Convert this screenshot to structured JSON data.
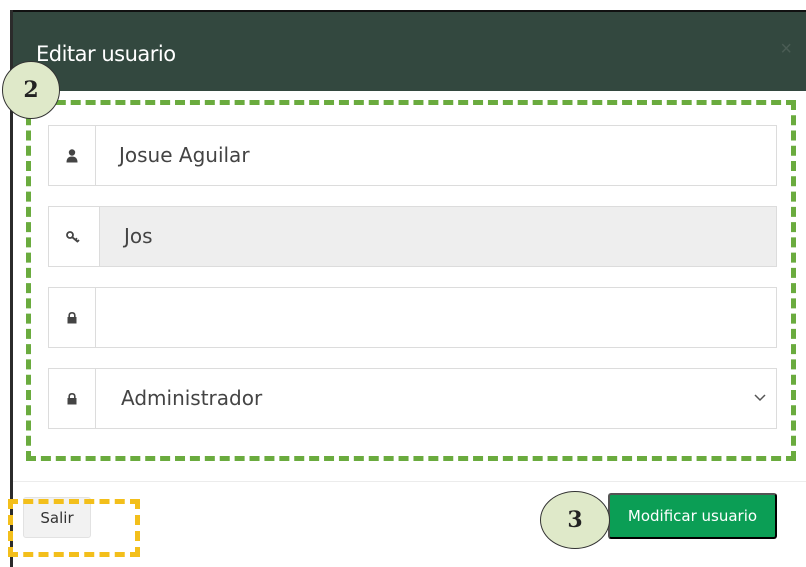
{
  "modal": {
    "title": "Editar usuario",
    "close_label": "×"
  },
  "form": {
    "name_value": "Josue Aguilar",
    "username_value": "Jos",
    "password_value": "",
    "role_selected": "Administrador"
  },
  "footer": {
    "exit_label": "Salir",
    "submit_label": "Modificar usuario"
  },
  "annotations": {
    "badge_2": "2",
    "badge_3": "3"
  },
  "icons": {
    "name": "user-icon",
    "username": "key-icon",
    "password": "lock-icon",
    "role": "lock-icon",
    "select": "chevron-down-icon"
  },
  "colors": {
    "header_bg": "#33483f",
    "primary_button": "#0b9e55",
    "annotation_green": "#6aab3e",
    "annotation_yellow": "#f3bf1b",
    "badge_fill": "#dfe9c9"
  }
}
